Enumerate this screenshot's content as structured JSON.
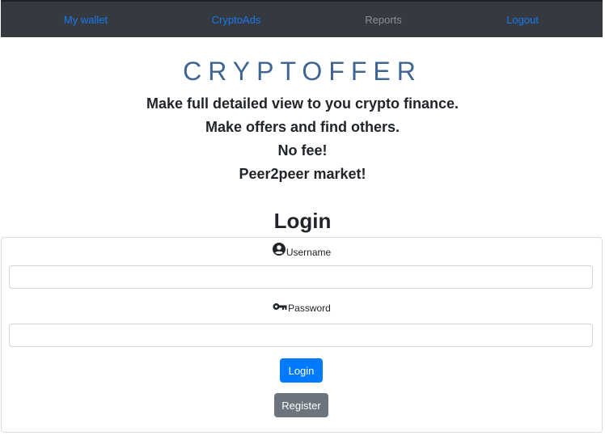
{
  "nav": {
    "items": [
      {
        "label": "My wallet"
      },
      {
        "label": "CryptoAds"
      },
      {
        "label": "Reports"
      },
      {
        "label": "Logout"
      }
    ]
  },
  "hero": {
    "brand": "CRYPTOFFER",
    "taglines": [
      "Make full detailed view to you crypto finance.",
      "Make offers and find others.",
      "No fee!",
      "Peer2peer market!"
    ]
  },
  "login": {
    "title": "Login",
    "username_label": "Username",
    "username_value": "",
    "password_label": "Password",
    "password_value": "",
    "login_button": "Login",
    "register_button": "Register"
  },
  "colors": {
    "navbar_bg": "#343a40",
    "nav_link": "#1a78f0",
    "nav_muted": "#8a9096",
    "brand": "#3f6592",
    "primary": "#007bff",
    "secondary": "#6c757d"
  },
  "icons": {
    "username": "user-circle-icon",
    "password": "key-icon"
  }
}
